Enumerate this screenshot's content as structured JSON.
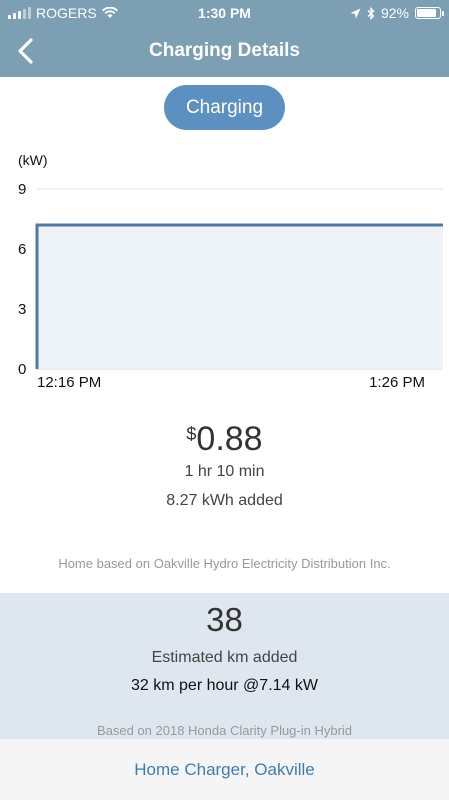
{
  "status_bar": {
    "carrier": "ROGERS",
    "time": "1:30 PM",
    "battery": "92%",
    "battery_level": 0.92,
    "icons": [
      "signal-icon",
      "wifi-icon",
      "location-icon",
      "bluetooth-icon",
      "battery-icon"
    ]
  },
  "nav": {
    "title": "Charging Details",
    "back_icon": "chevron-left-icon"
  },
  "status_pill": {
    "label": "Charging"
  },
  "chart_data": {
    "type": "area",
    "ylabel": "(kW)",
    "yticks": [
      0,
      3,
      6,
      9
    ],
    "ylim": [
      0,
      9
    ],
    "x_tick_labels": [
      "12:16 PM",
      "1:26 PM"
    ],
    "series": [
      {
        "x": [
          "12:16 PM",
          "12:16 PM",
          "1:26 PM"
        ],
        "values": [
          0,
          7.2,
          7.2
        ]
      }
    ],
    "grid": true,
    "line_color": "#4d7ba6",
    "fill_color": "#eef3f8"
  },
  "summary": {
    "currency": "$",
    "cost": "0.88",
    "duration": "1 hr 10 min",
    "energy_added": "8.27 kWh added",
    "rate_note": "Home based on Oakville Hydro Electricity Distribution Inc."
  },
  "estimate": {
    "value": "38",
    "label": "Estimated km added",
    "rate": "32 km per hour @7.14 kW",
    "vehicle_note": "Based on 2018 Honda Clarity Plug-in Hybrid"
  },
  "footer": {
    "location_link": "Home Charger, Oakville"
  },
  "colors": {
    "header": "#7c9fb4",
    "pill": "#5b90c0",
    "panel": "#dee7ef",
    "link": "#3e7db0"
  }
}
